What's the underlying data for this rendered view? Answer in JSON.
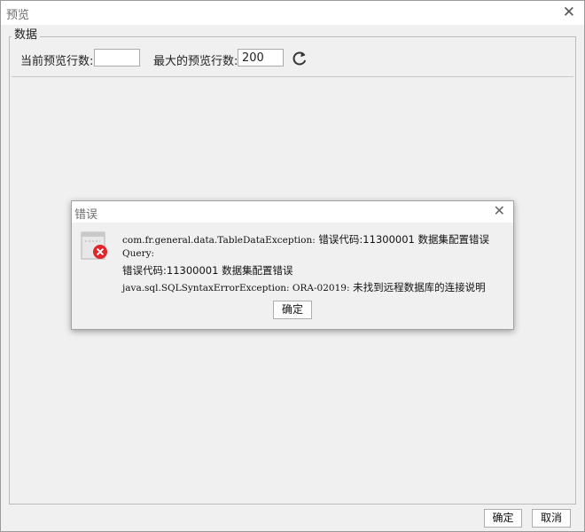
{
  "window": {
    "title": "预览"
  },
  "group": {
    "legend": "数据"
  },
  "controls": {
    "current_rows_label": "当前预览行数:",
    "current_rows_value": "",
    "max_rows_label": "最大的预览行数:",
    "max_rows_value": "200"
  },
  "footer": {
    "ok_label": "确定",
    "cancel_label": "取消"
  },
  "error_dialog": {
    "title": "错误",
    "line1_code": "com.fr.general.data.TableDataException:",
    "line1_text": " 错误代码:11300001 数据集配置错误",
    "line2": "Query:",
    "line3": "错误代码:11300001 数据集配置错误",
    "line4_code": "java.sql.SQLSyntaxErrorException: ORA-02019:",
    "line4_text": " 未找到远程数据库的连接说明",
    "ok_label": "确定"
  }
}
